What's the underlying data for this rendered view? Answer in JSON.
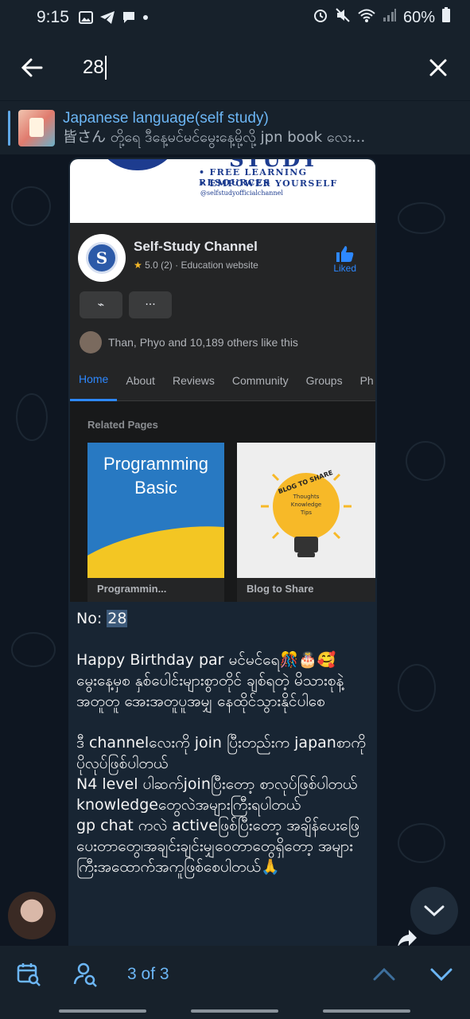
{
  "status_bar": {
    "time": "9:15",
    "battery": "60%"
  },
  "search": {
    "query": "28"
  },
  "pinned": {
    "title": "Japanese language(self study)",
    "preview": "皆さん တို့ရေ  ဒီနေ့မင်မင်မွေးနေ့မို့လို့ jpn book လေး..."
  },
  "media": {
    "banner_word": "STUDY",
    "banner_line1": "• FREE LEARNING RESOURCES",
    "banner_line2": "• EMPOWER YOURSELF",
    "banner_handle": "@selfstudyofficialchannel",
    "page_name": "Self-Study Channel",
    "rating": "5.0 (2) · Education website",
    "liked_label": "Liked",
    "messenger_glyph": "⌁",
    "more_glyph": "···",
    "likes_text": "Than, Phyo and 10,189 others like this",
    "tabs": [
      "Home",
      "About",
      "Reviews",
      "Community",
      "Groups",
      "Ph"
    ],
    "related_title": "Related Pages",
    "card1_art_line1": "Programming",
    "card1_art_line2": "Basic",
    "card1_label": "Programmin...",
    "card2_arc": "BLOG TO SHARE",
    "card2_sub1": "Thoughts",
    "card2_sub2": "Knowledge",
    "card2_sub3": "Tips",
    "card2_label": "Blog to Share"
  },
  "message": {
    "no_label": "No: ",
    "no_value": "28",
    "para1": "Happy Birthday par မင်မင်ရေ🎊🎂🥰 မွေးနေ့မှစ နှစ်ပေါင်းများစွာတိုင် ချစ်ရတဲ့ မိသားစုနဲ့အတူတူ အေးအတူပူအမျှ နေထိုင်သွားနိုင်ပါစေ",
    "para2": "ဒီ channelလေးကို join ပြီးတည်းက japanစာကို ပိုလုပ်ဖြစ်ပါတယ်",
    "para3": " N4 level ပါဆက်joinပြီးတော့ စာလုပ်ဖြစ်ပါတယ်",
    "para4": " knowledgeတွေလဲအများကြီးရပါတယ်",
    "para5": " gp chat ကလဲ activeဖြစ်ပြီးတော့ အချိန်ပေးဖြေပေးတာတွေ၊အချင်းချင်းမျှဝေတာတွေရှိတော့ အများကြီးအထောက်အကူဖြစ်စေပါတယ်🙏"
  },
  "bottom_bar": {
    "counter": "3 of 3"
  },
  "colors": {
    "accent": "#6cb6f5",
    "header_bg": "#17212b",
    "chat_bg": "#0e1621",
    "bubble_bg": "#182533"
  }
}
